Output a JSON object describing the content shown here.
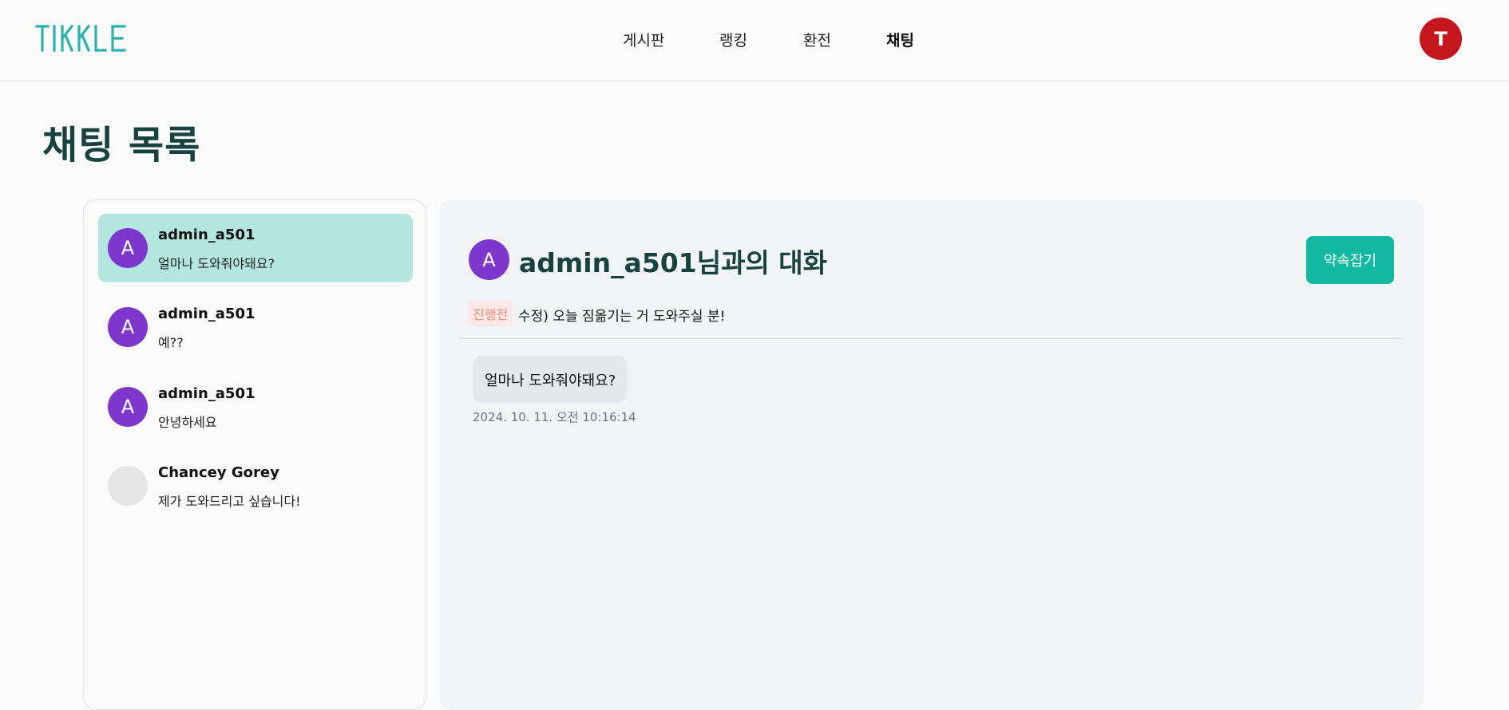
{
  "header": {
    "logo_text": "TIKKLE",
    "nav": [
      "게시판",
      "랭킹",
      "환전",
      "채팅"
    ],
    "active_nav": "채팅",
    "user_initial": "T"
  },
  "page_title": "채팅 목록",
  "chat_list": [
    {
      "initial": "A",
      "name": "admin_a501",
      "preview": "얼마나 도와줘야돼요?"
    },
    {
      "initial": "A",
      "name": "admin_a501",
      "preview": "예??"
    },
    {
      "initial": "A",
      "name": "admin_a501",
      "preview": "안녕하세요"
    },
    {
      "initial": "",
      "name": "Chancey Gorey",
      "preview": "제가 도와드리고 싶습니다!"
    }
  ],
  "conversation": {
    "initial": "A",
    "title": "admin_a501님과의 대화",
    "appoint_label": "약속잡기",
    "status": "진행전",
    "post_title": "수정) 오늘 짐옮기는 거 도와주실 분!",
    "messages": [
      {
        "text": "얼마나 도와줘야돼요?",
        "time": "2024. 10. 11. 오전 10:16:14"
      }
    ]
  },
  "colors": {
    "brand": "#13b8a3",
    "title": "#17423f",
    "selected_item": "#b3e6de",
    "avatar_purple": "#7e37cc",
    "user_avatar": "#c5161d"
  }
}
